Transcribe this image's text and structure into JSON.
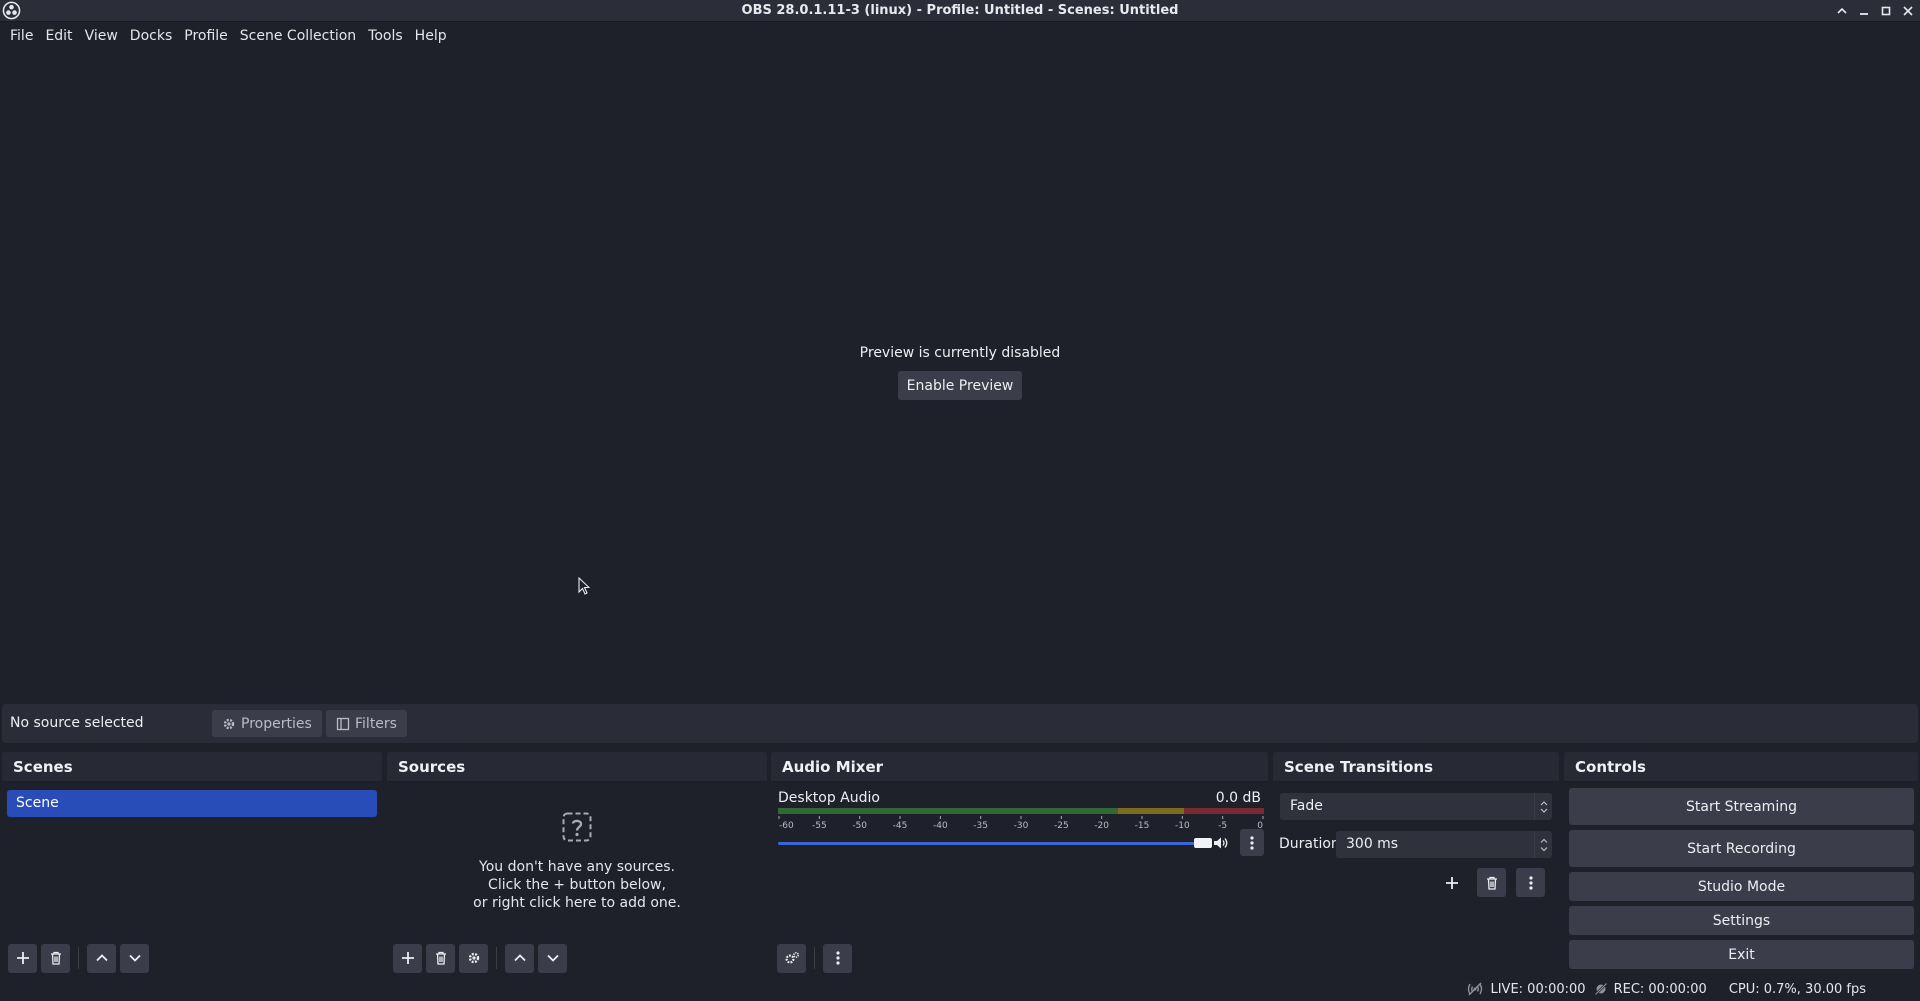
{
  "window": {
    "title": "OBS 28.0.1.11-3 (linux) - Profile: Untitled - Scenes: Untitled"
  },
  "menu": [
    {
      "label": "File"
    },
    {
      "label": "Edit"
    },
    {
      "label": "View"
    },
    {
      "label": "Docks"
    },
    {
      "label": "Profile"
    },
    {
      "label": "Scene Collection"
    },
    {
      "label": "Tools"
    },
    {
      "label": "Help"
    }
  ],
  "preview": {
    "message": "Preview is currently disabled",
    "enable_label": "Enable Preview"
  },
  "context": {
    "selection": "No source selected",
    "properties_label": "Properties",
    "filters_label": "Filters"
  },
  "docks": {
    "scenes": {
      "title": "Scenes",
      "items": [
        {
          "name": "Scene",
          "selected": true
        }
      ]
    },
    "sources": {
      "title": "Sources",
      "empty_lines": [
        "You don't have any sources.",
        "Click the + button below,",
        "or right click here to add one."
      ]
    },
    "mixer": {
      "title": "Audio Mixer",
      "channel": {
        "name": "Desktop Audio",
        "level": "0.0 dB",
        "volume_fraction": 1.0
      },
      "scale": [
        "-60",
        "-55",
        "-50",
        "-45",
        "-40",
        "-35",
        "-30",
        "-25",
        "-20",
        "-15",
        "-10",
        "-5",
        "0"
      ]
    },
    "transitions": {
      "title": "Scene Transitions",
      "selected": "Fade",
      "duration_label": "Duration",
      "duration_value": "300 ms"
    },
    "controls": {
      "title": "Controls",
      "buttons": [
        "Start Streaming",
        "Start Recording",
        "Studio Mode",
        "Settings",
        "Exit"
      ]
    }
  },
  "status": {
    "live": "LIVE: 00:00:00",
    "rec": "REC: 00:00:00",
    "cpu": "CPU: 0.7%, 30.00 fps"
  },
  "colors": {
    "background": "#1f212a",
    "panel": "#2a2d37",
    "button": "#3b3e4a",
    "accent": "#284cb8",
    "slider": "#3a67d6"
  }
}
